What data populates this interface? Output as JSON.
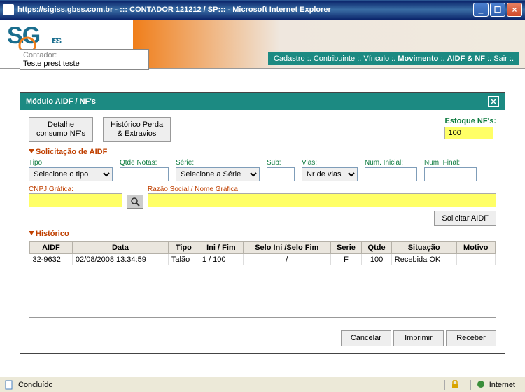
{
  "window": {
    "title": "https://sigiss.gbss.com.br - ::: CONTADOR 121212 / SP::: - Microsoft Internet Explorer"
  },
  "logo_text": "SIGISS",
  "contador": {
    "label": "Contador:",
    "value": "Teste prest teste"
  },
  "menu": {
    "items": [
      "Cadastro",
      "Contribuinte",
      "Vínculo",
      "Movimento",
      "AIDF & NF",
      "Sair"
    ],
    "active_index": 3,
    "sep": " :. "
  },
  "module": {
    "title": "Módulo AIDF / NF's",
    "buttons": {
      "detalhe": "Detalhe\nconsumo NF's",
      "historico_pe": "Histórico Perda\n& Extravios"
    },
    "estoque": {
      "label": "Estoque NF's:",
      "value": "100"
    },
    "section_solicitacao": "Solicitação de AIDF",
    "form": {
      "tipo": {
        "label": "Tipo:",
        "selected": "Selecione o tipo"
      },
      "qtde": {
        "label": "Qtde Notas:",
        "value": ""
      },
      "serie": {
        "label": "Série:",
        "selected": "Selecione a Série"
      },
      "sub": {
        "label": "Sub:",
        "value": ""
      },
      "vias": {
        "label": "Vias:",
        "selected": "Nr de vias"
      },
      "num_ini": {
        "label": "Num. Inicial:",
        "value": ""
      },
      "num_fim": {
        "label": "Num. Final:",
        "value": ""
      }
    },
    "grafica": {
      "cnpj_label": "CNPJ Gráfica:",
      "cnpj_value": "",
      "razao_label": "Razão Social / Nome Gráfica",
      "razao_value": ""
    },
    "btn_solicitar": "Solicitar AIDF",
    "section_historico": "Histórico",
    "grid": {
      "headers": [
        "AIDF",
        "Data",
        "Tipo",
        "Ini / Fim",
        "Selo Ini /Selo Fim",
        "Serie",
        "Qtde",
        "Situação",
        "Motivo"
      ],
      "rows": [
        {
          "aidf": "32-9632",
          "data": "02/08/2008 13:34:59",
          "tipo": "Talão",
          "inifim": "1 / 100",
          "selo": "/",
          "serie": "F",
          "qtde": "100",
          "situacao": "Recebida OK",
          "motivo": ""
        }
      ]
    },
    "bottom": {
      "cancelar": "Cancelar",
      "imprimir": "Imprimir",
      "receber": "Receber"
    }
  },
  "status": {
    "text": "Concluído",
    "zone": "Internet"
  }
}
